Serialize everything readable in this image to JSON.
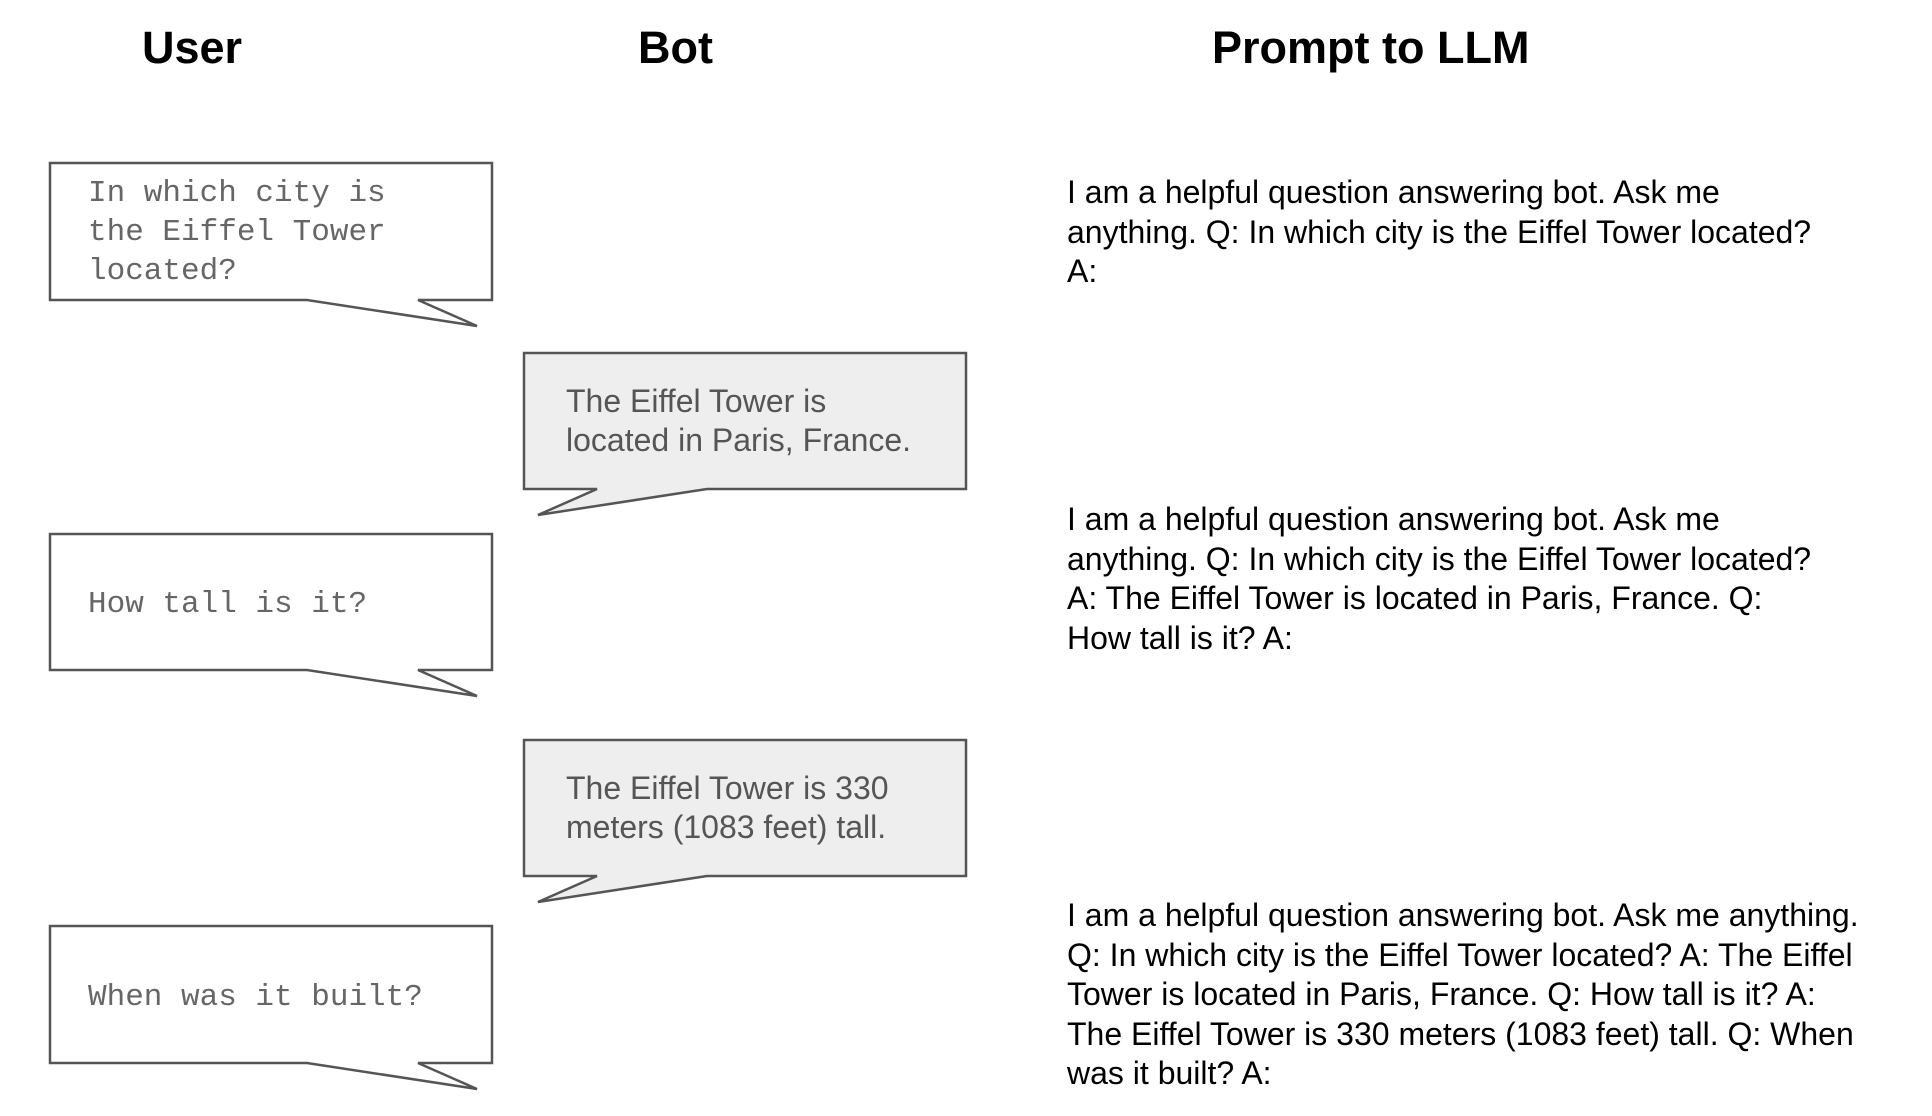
{
  "headers": {
    "user": "User",
    "bot": "Bot",
    "prompt": "Prompt to LLM"
  },
  "colors": {
    "bubble_border": "#555555",
    "bot_fill": "#eeeeee",
    "user_fill": "#ffffff",
    "user_text": "#666666",
    "bot_text": "#555555"
  },
  "user_messages": [
    {
      "lines": [
        "In which city is",
        "the Eiffel Tower",
        "located?"
      ]
    },
    {
      "lines": [
        "How tall is it?"
      ]
    },
    {
      "lines": [
        "When was it built?"
      ]
    }
  ],
  "bot_messages": [
    {
      "lines": [
        "The Eiffel Tower is",
        "located in Paris, France."
      ]
    },
    {
      "lines": [
        "The Eiffel Tower is 330",
        "meters (1083 feet) tall."
      ]
    }
  ],
  "prompts": [
    {
      "lines": [
        "I am a helpful question answering bot. Ask me",
        "anything. Q: In which city is the Eiffel Tower located?",
        "A:"
      ]
    },
    {
      "lines": [
        "I am a helpful question answering bot. Ask me",
        "anything. Q: In which city is the Eiffel Tower located?",
        "A: The Eiffel Tower is located in Paris, France. Q:",
        "How tall is it? A:"
      ]
    },
    {
      "lines": [
        "I am a helpful question answering bot. Ask me anything.",
        "Q: In which city is the Eiffel Tower located? A: The Eiffel",
        "Tower is located in Paris, France. Q: How tall is it? A:",
        "The Eiffel Tower is 330 meters (1083 feet) tall. Q: When",
        "was it built? A:"
      ]
    }
  ]
}
